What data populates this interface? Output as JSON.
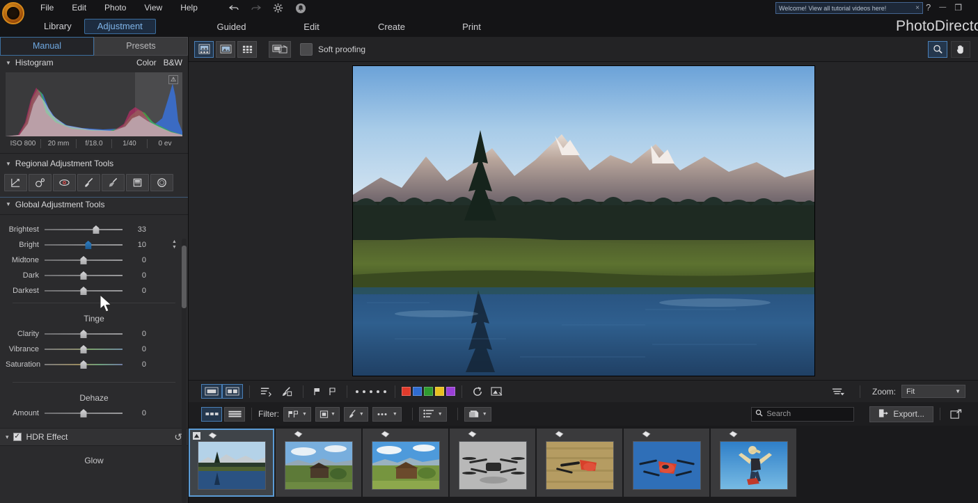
{
  "menubar": {
    "items": [
      "File",
      "Edit",
      "Photo",
      "View",
      "Help"
    ],
    "icons": [
      "undo-icon",
      "redo-icon",
      "gear-icon",
      "notification-icon"
    ]
  },
  "welcome": {
    "text": "Welcome! View all tutorial videos here!",
    "close": "×"
  },
  "window": {
    "help": "?",
    "minimize": "—",
    "restore": "❐"
  },
  "modules": {
    "primary": [
      {
        "label": "Library",
        "active": false
      },
      {
        "label": "Adjustment",
        "active": true
      }
    ],
    "secondary": [
      {
        "label": "Guided"
      },
      {
        "label": "Edit"
      },
      {
        "label": "Create"
      },
      {
        "label": "Print"
      }
    ],
    "brand": "PhotoDirector"
  },
  "left_panel": {
    "tabs": [
      {
        "label": "Manual",
        "active": true
      },
      {
        "label": "Presets",
        "active": false
      }
    ],
    "histogram": {
      "title": "Histogram",
      "color_mode": "Color",
      "bw_mode": "B&W",
      "clip_warning": "⚠",
      "exif": [
        "ISO 800",
        "20 mm",
        "f/18.0",
        "1/40",
        "0 ev"
      ]
    },
    "regional": {
      "title": "Regional Adjustment Tools",
      "tools": [
        "adjustment-curve-icon",
        "spot-removal-icon",
        "red-eye-icon",
        "adjustment-brush-icon",
        "smart-brush-icon",
        "gradient-mask-icon",
        "radial-mask-icon"
      ]
    },
    "global": {
      "title": "Global Adjustment Tools",
      "tone_sliders": [
        {
          "label": "Brightest",
          "value": "33",
          "pos": 66,
          "active": false
        },
        {
          "label": "Bright",
          "value": "10",
          "pos": 56,
          "active": true
        },
        {
          "label": "Midtone",
          "value": "0",
          "pos": 50,
          "active": false
        },
        {
          "label": "Dark",
          "value": "0",
          "pos": 50,
          "active": false
        },
        {
          "label": "Darkest",
          "value": "0",
          "pos": 50,
          "active": false
        }
      ],
      "tinge": {
        "title": "Tinge",
        "sliders": [
          {
            "label": "Clarity",
            "value": "0",
            "pos": 50,
            "grad": ""
          },
          {
            "label": "Vibrance",
            "value": "0",
            "pos": 50,
            "grad": "grad-v"
          },
          {
            "label": "Saturation",
            "value": "0",
            "pos": 50,
            "grad": "grad-s"
          }
        ]
      },
      "dehaze": {
        "title": "Dehaze",
        "sliders": [
          {
            "label": "Amount",
            "value": "0",
            "pos": 50,
            "grad": ""
          }
        ]
      },
      "hdr_effect": {
        "label": "HDR Effect",
        "checked": true,
        "check_glyph": "✓",
        "reset_icon": "reset-icon",
        "glow_title": "Glow"
      }
    }
  },
  "viewbar": {
    "buttons": [
      {
        "name": "view-compare-icon",
        "active": true
      },
      {
        "name": "view-single-icon",
        "active": false
      },
      {
        "name": "view-grid-icon",
        "active": false
      },
      {
        "name": "view-duplicate-icon",
        "active": false
      }
    ],
    "soft_proofing": "Soft proofing",
    "right_tools": [
      {
        "name": "zoom-tool-icon",
        "active": true
      },
      {
        "name": "hand-tool-icon",
        "active": false
      }
    ]
  },
  "bottom_toolbar": {
    "view_buttons": [
      "single-view-icon",
      "compare-view-icon"
    ],
    "list_icon": "sort-list-icon",
    "pencil_icon": "edit-tag-icon",
    "flag_icons": [
      "flag-pick-icon",
      "flag-reject-icon"
    ],
    "rating_dots": 5,
    "color_swatches": [
      "#e03b2c",
      "#2f6cd1",
      "#2f9b2f",
      "#e8c020",
      "#9a3fd6"
    ],
    "rotate_icon": "rotate-right-icon",
    "compare-icon": "tag-view-icon",
    "filter_sort_icon": "filter-sort-icon",
    "zoom_label": "Zoom:",
    "zoom_value": "Fit"
  },
  "filter_bar": {
    "layout_buttons": [
      "filmstrip-view-icon",
      "list-view-icon"
    ],
    "filter_label": "Filter:",
    "filter_buttons": [
      "flag-filter-icon",
      "rating-filter-icon",
      "color-filter-icon",
      "more-filter-icon"
    ],
    "sort_button": "sort-order-icon",
    "stack_button": "stack-icon",
    "search": {
      "placeholder": "Search",
      "value": "",
      "icon": "search-icon",
      "clear": "×"
    },
    "export": {
      "label": "Export...",
      "icon": "export-icon"
    },
    "share_icon": "share-icon"
  },
  "filmstrip": {
    "thumbnails": [
      {
        "name": "mountain-lake-reflection",
        "selected": true,
        "edited": true,
        "tagged": true
      },
      {
        "name": "barn-landscape-1",
        "selected": false,
        "edited": false,
        "tagged": true
      },
      {
        "name": "barn-landscape-2",
        "selected": false,
        "edited": false,
        "tagged": true
      },
      {
        "name": "drone-grayscale",
        "selected": false,
        "edited": false,
        "tagged": true
      },
      {
        "name": "drone-red-field",
        "selected": false,
        "edited": false,
        "tagged": true
      },
      {
        "name": "drone-blue-sky",
        "selected": false,
        "edited": false,
        "tagged": true
      },
      {
        "name": "snowboarder-jump",
        "selected": false,
        "edited": false,
        "tagged": true
      }
    ]
  },
  "colors": {
    "accent": "#5b9bd5",
    "panel": "#2b2b2d",
    "bg": "#1a1a1c",
    "toolbar": "#232325"
  }
}
